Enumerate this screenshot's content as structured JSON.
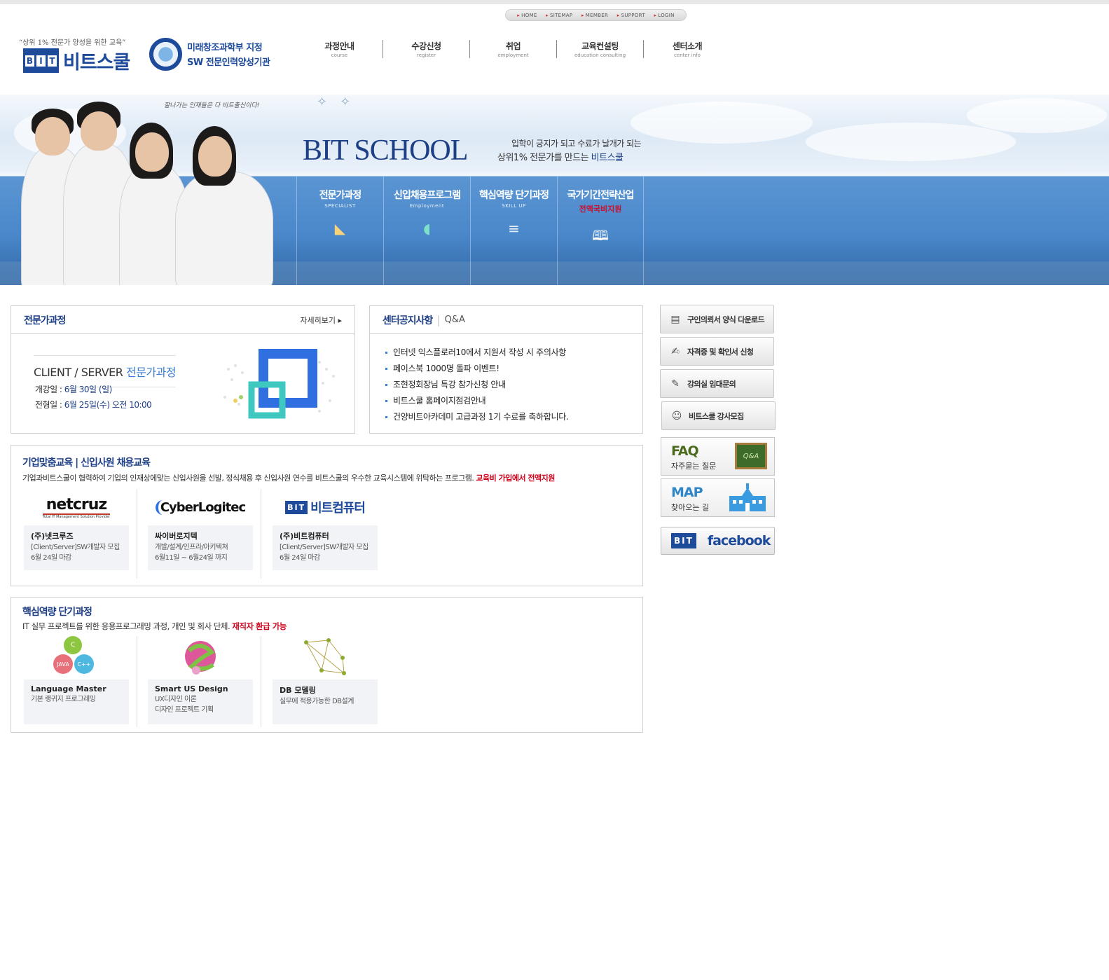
{
  "util_nav": [
    "HOME",
    "SITEMAP",
    "MEMBER",
    "SUPPORT",
    "LOGIN"
  ],
  "logo": {
    "slogan": "“상위 1% 전문가 양성을 위한 교육”",
    "bit": [
      "B",
      "I",
      "T"
    ],
    "name": "비트스쿨",
    "designation_line1": "미래창조과학부 지정",
    "designation_line2": "SW 전문인력양성기관"
  },
  "gnb": [
    {
      "ko": "과정안내",
      "en": "course"
    },
    {
      "ko": "수강신청",
      "en": "register"
    },
    {
      "ko": "취업",
      "en": "employment"
    },
    {
      "ko": "교육컨설팅",
      "en": "education consulting"
    },
    {
      "ko": "센터소개",
      "en": "center info"
    }
  ],
  "hero": {
    "tagline": "잘나가는 인재들은 다 비트출신이다!",
    "title": "BIT SCHOOL",
    "line1": "입학이 긍지가 되고 수료가 날개가 되는",
    "line2_pre": "상위1% 전문가",
    "line2_mid": "를 만드는 ",
    "line2_brand": "비트스쿨",
    "menu": [
      {
        "title": "전문가과정",
        "sub": "SPECIALIST",
        "icon": "book-icon"
      },
      {
        "title": "신입채용프로그램",
        "sub": "Employment",
        "icon": "mouse-icon"
      },
      {
        "title": "핵심역량 단기과정",
        "sub": "SKILL UP",
        "icon": "stack-icon"
      },
      {
        "title": "국가기간전략산업",
        "sub": "전액국비지원",
        "icon": "open-book-icon"
      }
    ]
  },
  "expert": {
    "title": "전문가과정",
    "more": "자세히보기",
    "course_pre": "CLIENT / SERVER ",
    "course_hl": "전문가과정",
    "open_label": "개강일 : ",
    "open_value": "6월 30일 (일)",
    "screen_label": "전형일 : ",
    "screen_value": "6월 25일(수) 오전 10:00"
  },
  "notice": {
    "title": "센터공지사항",
    "tab2": "Q&A",
    "items": [
      "인터넷 익스플로러10에서 지원서 작성 시 주의사항",
      "페이스북 1000명 돌파 이벤트!",
      "조현정회장님 특강 참가신청 안내",
      "비트스쿨 홈페이지점검안내",
      "건양비트아카데미 고급과정 1기 수료를 축하합니다."
    ]
  },
  "corp": {
    "title": "기업맞춤교육  |  신입사원 채용교육",
    "desc": "기업과비트스쿨이 협력하여 기업의 인재상에맞는 신입사원을 선발, 정식채용 후 신입사원 연수를 비트스쿨의 우수한 교육시스템에  위탁하는 프로그램. ",
    "desc_hl": "교육비 가입에서 전액지원",
    "cards": [
      {
        "logo": "netcruz",
        "logo_sub": "Total IT Management Solution Provider",
        "name": "(주)넷크루즈",
        "d1": "[Client/Server]SW개발자 모집",
        "d2": "6월 24일 마감"
      },
      {
        "logo": "CyberLogitec",
        "logo_sub": "",
        "name": "싸이버로지텍",
        "d1": "개발/설계/인프라/아키텍쳐",
        "d2": "6월11일 ~ 6월24일 까지"
      },
      {
        "logo": "비트컴퓨터",
        "logo_sub": "",
        "name": "(주)비트컴퓨터",
        "d1": "[Client/Server]SW개발자 모집",
        "d2": "6월 24일 마감"
      }
    ]
  },
  "short": {
    "title": "핵심역량 단기과정",
    "desc": "IT 실무 프로젝트를 위한 응용프로그래밍 과정, 개인 및 회사 단체. ",
    "desc_hl": "재직자 환급 가능",
    "bubbles": [
      "C",
      "JAVA",
      "C++"
    ],
    "cards": [
      {
        "name": "Language Master",
        "d1": "기본 랭귀지 프로그래밍",
        "d2": ""
      },
      {
        "name": "Smart US Design",
        "d1": "UX디자인 이론",
        "d2": "디자인 프로젝트 기획"
      },
      {
        "name": "DB 모델링",
        "d1": "실무에 적용가능한 DB설계",
        "d2": ""
      }
    ]
  },
  "side": {
    "buttons": [
      {
        "label": "구인의뢰서 양식 다운로드",
        "icon": "document-icon"
      },
      {
        "label": "자격증 및 확인서 신청",
        "icon": "certificate-icon"
      },
      {
        "label": "강의실 임대문의",
        "icon": "pen-icon"
      },
      {
        "label": "비트스쿨 강사모집",
        "icon": "people-icon"
      }
    ],
    "faq": {
      "title": "FAQ",
      "sub": "자주묻는 질문",
      "board": "Q&A"
    },
    "map": {
      "title": "MAP",
      "sub": "찾아오는 길"
    },
    "facebook": {
      "bit": "BIT",
      "text": "facebook"
    }
  },
  "colors": {
    "brand": "#1d4a9b",
    "accent": "#3a7fd5",
    "highlight": "#d0021b"
  }
}
